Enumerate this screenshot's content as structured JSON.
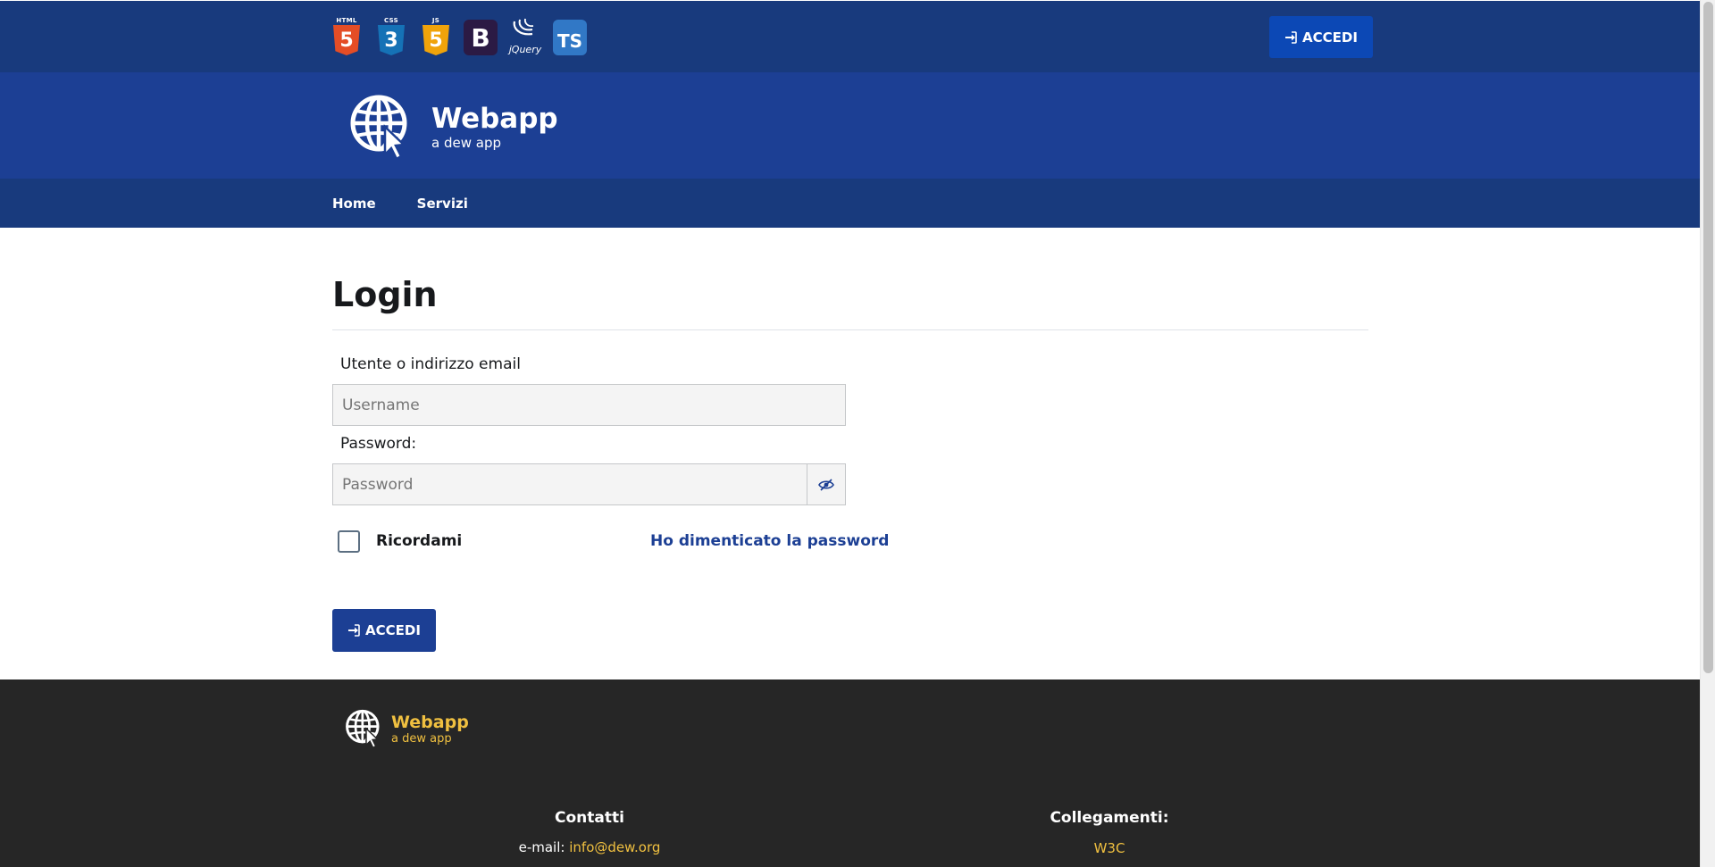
{
  "tech_icons": [
    {
      "name": "html5-icon",
      "caption": "HTML",
      "glyph": "5",
      "color": "#e44d26"
    },
    {
      "name": "css3-icon",
      "caption": "CSS",
      "glyph": "3",
      "color": "#1572b6"
    },
    {
      "name": "javascript-icon",
      "caption": "JS",
      "glyph": "5",
      "color": "#f0a30a"
    },
    {
      "name": "bootstrap-icon",
      "caption": "",
      "glyph": "B",
      "color": "#2b1a44"
    },
    {
      "name": "jquery-icon",
      "caption": "jQuery",
      "glyph": "",
      "color": ""
    },
    {
      "name": "typescript-icon",
      "caption": "",
      "glyph": "TS",
      "color": "#3178c6"
    }
  ],
  "header": {
    "login_button": "ACCEDI",
    "brand_title": "Webapp",
    "brand_tagline": "a dew app"
  },
  "nav": {
    "home": "Home",
    "services": "Servizi"
  },
  "login": {
    "title": "Login",
    "username_label": "Utente o indirizzo email",
    "username_placeholder": "Username",
    "username_value": "",
    "password_label": "Password:",
    "password_placeholder": "Password",
    "password_value": "",
    "remember_label": "Ricordami",
    "remember_checked": false,
    "forgot_link": "Ho dimenticato la password",
    "submit_label": "ACCEDI"
  },
  "footer": {
    "brand_title": "Webapp",
    "brand_tagline": "a dew app",
    "contacts_heading": "Contatti",
    "email_label": "e-mail:",
    "email_value": "info@dew.org",
    "links_heading": "Collegamenti:",
    "link_w3c": "W3C"
  },
  "colors": {
    "slim_header": "#183a7d",
    "center_header": "#1c3f94",
    "primary": "#1c3f94",
    "accent_button": "#0c48b5",
    "footer_bg": "#262626",
    "footer_accent": "#f0c040"
  }
}
